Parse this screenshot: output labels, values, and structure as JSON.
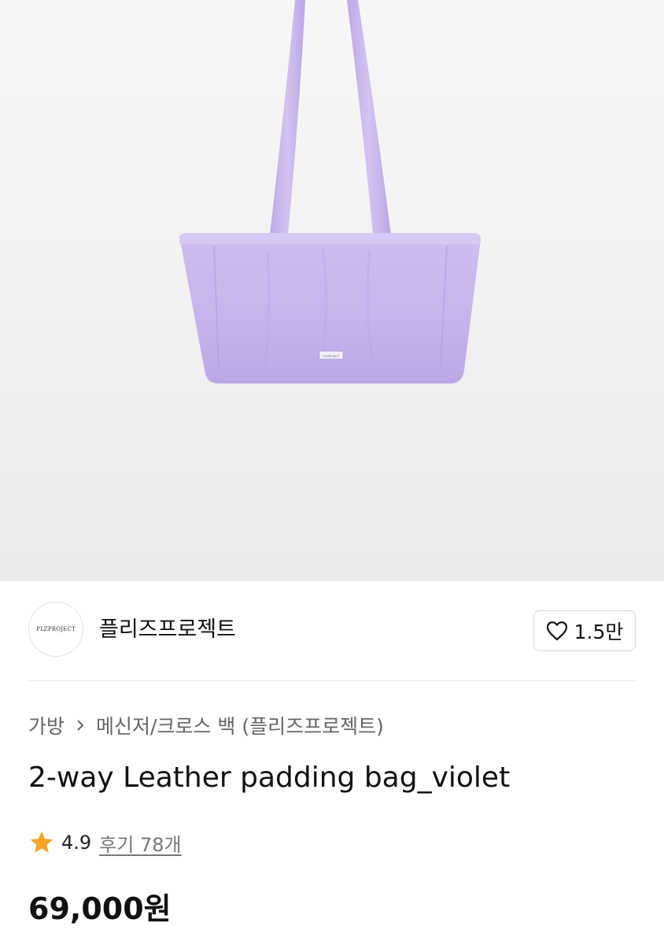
{
  "brand": {
    "logo_text": "PLZPROJECT",
    "name": "플리즈프로젝트",
    "like_count": "1.5만"
  },
  "breadcrumb": {
    "category": "가방",
    "subcategory": "메신저/크로스 백 (플리즈프로젝트)"
  },
  "product": {
    "title": "2-way Leather padding bag_violet",
    "rating": "4.9",
    "review_label": "후기 78개",
    "price": "69,000원",
    "image_label": "PLZPROJECT"
  },
  "colors": {
    "bag": "#c9b8ee",
    "star": "#f6a326",
    "text_primary": "#111111",
    "text_secondary": "#666666"
  },
  "icons": {
    "like": "heart-outline-icon",
    "breadcrumb_separator": "chevron-right-icon",
    "rating": "star-icon"
  }
}
